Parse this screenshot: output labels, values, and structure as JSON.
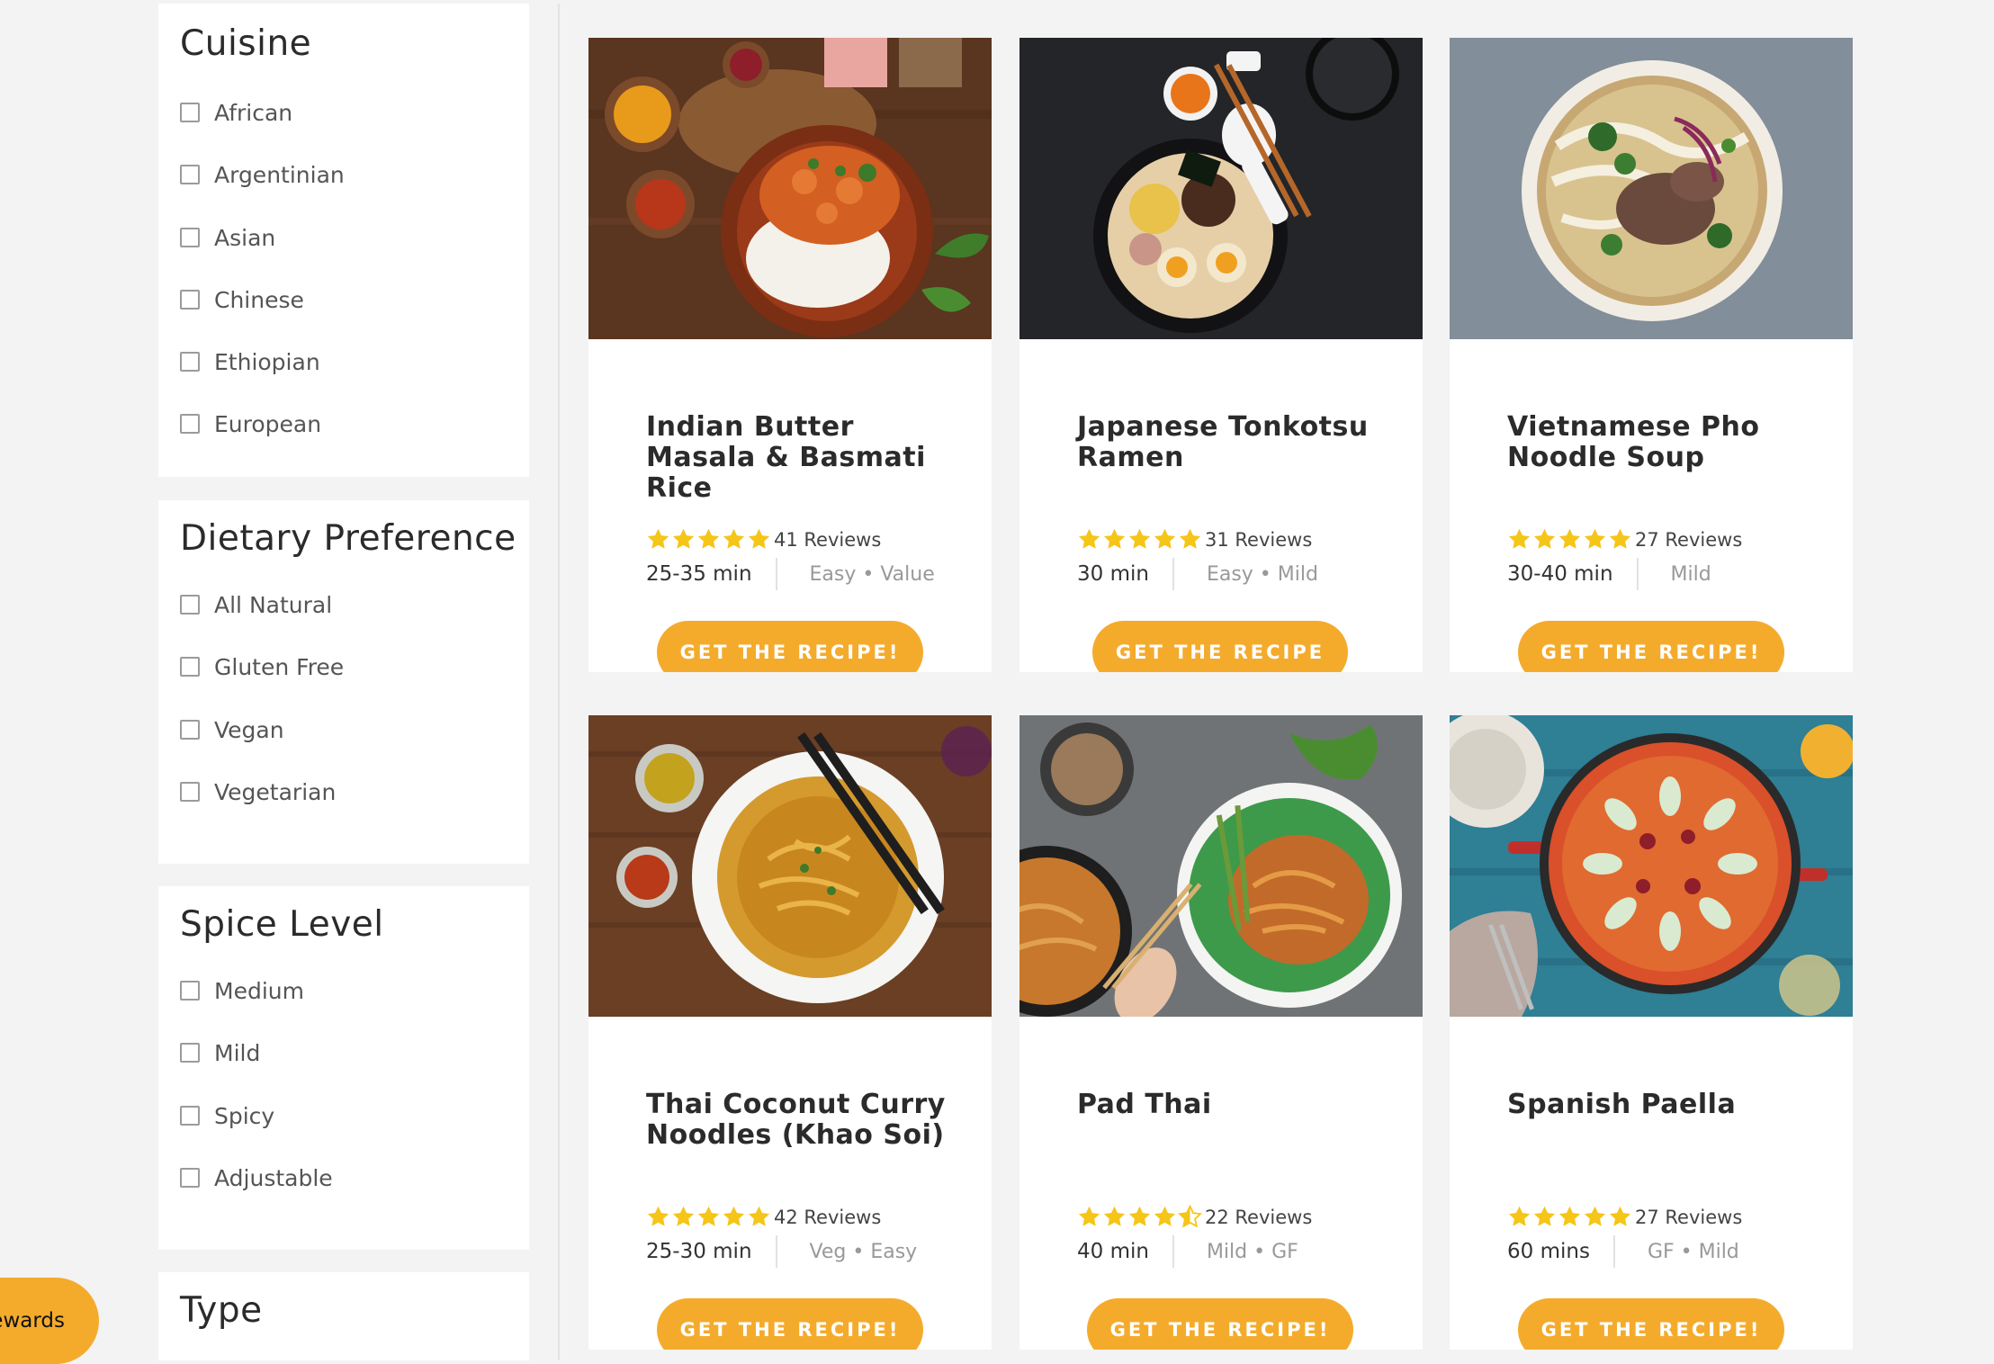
{
  "sidebar": {
    "cuisine": {
      "title": "Cuisine",
      "options": [
        "African",
        "Argentinian",
        "Asian",
        "Chinese",
        "Ethiopian",
        "European"
      ]
    },
    "dietary": {
      "title": "Dietary Preference",
      "options": [
        "All Natural",
        "Gluten Free",
        "Vegan",
        "Vegetarian"
      ]
    },
    "spice": {
      "title": "Spice Level",
      "options": [
        "Medium",
        "Mild",
        "Spicy",
        "Adjustable"
      ]
    },
    "type": {
      "title": "Type"
    }
  },
  "rewards": {
    "label": "ewards"
  },
  "recipes": [
    {
      "title": "Indian Butter Masala & Basmati Rice",
      "rating": 5,
      "reviews": "41 Reviews",
      "time": "25-35 min",
      "tags": "Easy • Value",
      "button": "GET THE RECIPE!"
    },
    {
      "title": "Japanese Tonkotsu Ramen",
      "rating": 5,
      "reviews": "31 Reviews",
      "time": "30 min",
      "tags": "Easy • Mild",
      "button": "GET THE RECIPE"
    },
    {
      "title": "Vietnamese Pho Noodle Soup",
      "rating": 5,
      "reviews": "27 Reviews",
      "time": "30-40 min",
      "tags": "Mild",
      "button": "GET THE RECIPE!"
    },
    {
      "title": "Thai Coconut Curry Noodles (Khao Soi)",
      "rating": 5,
      "reviews": "42 Reviews",
      "time": "25-30 min",
      "tags": "Veg • Easy",
      "button": "GET THE RECIPE!"
    },
    {
      "title": "Pad Thai",
      "rating": 4.5,
      "reviews": "22 Reviews",
      "time": "40 min",
      "tags": "Mild • GF",
      "button": "GET THE RECIPE!"
    },
    {
      "title": "Spanish Paella",
      "rating": 5,
      "reviews": "27 Reviews",
      "time": "60 mins",
      "tags": "GF • Mild",
      "button": "GET THE RECIPE!"
    }
  ],
  "colors": {
    "accent": "#f4ab2c",
    "star": "#f5c518",
    "background": "#f3f3f3"
  },
  "icons": {
    "star": "star-icon",
    "half_star": "star-half-icon",
    "checkbox": "checkbox"
  }
}
